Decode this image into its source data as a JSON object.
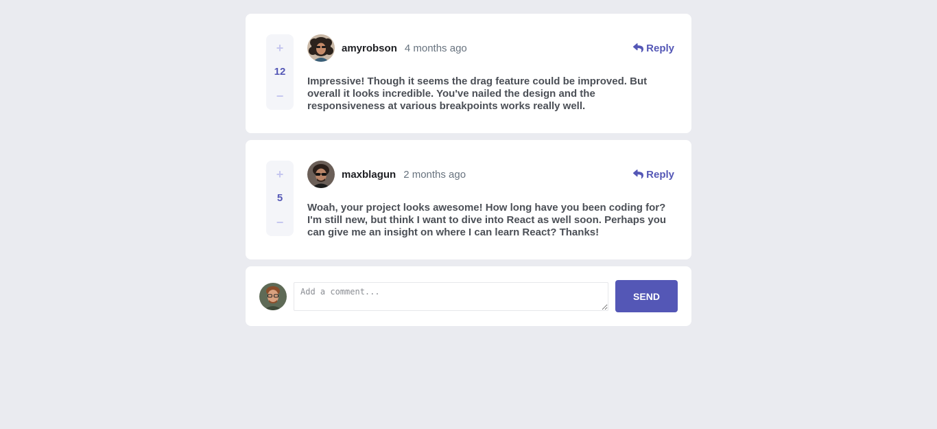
{
  "comments": [
    {
      "score": "12",
      "username": "amyrobson",
      "created_at": "4 months ago",
      "reply_label": "Reply",
      "content": "Impressive! Though it seems the drag feature could be improved. But overall it looks incredible. You've nailed the design and the responsiveness at various breakpoints works really well."
    },
    {
      "score": "5",
      "username": "maxblagun",
      "created_at": "2 months ago",
      "reply_label": "Reply",
      "content": "Woah, your project looks awesome! How long have you been coding for? I'm still new, but think I want to dive into React as well soon. Perhaps you can give me an insight on where I can learn React? Thanks!"
    }
  ],
  "vote": {
    "plus": "+",
    "minus": "−"
  },
  "add_comment": {
    "placeholder": "Add a comment...",
    "value": "",
    "send_label": "SEND"
  },
  "colors": {
    "background": "#eaebf0",
    "card": "#ffffff",
    "accent": "#5457b6",
    "vote_muted": "#c5c6ef",
    "vote_bg": "#f4f5f9",
    "username": "#1d1e22",
    "timestamp": "#67727e",
    "body_text": "#4b4f56"
  },
  "icons": {
    "reply": "reply-arrow-icon",
    "plus": "plus-icon",
    "minus": "minus-icon"
  }
}
